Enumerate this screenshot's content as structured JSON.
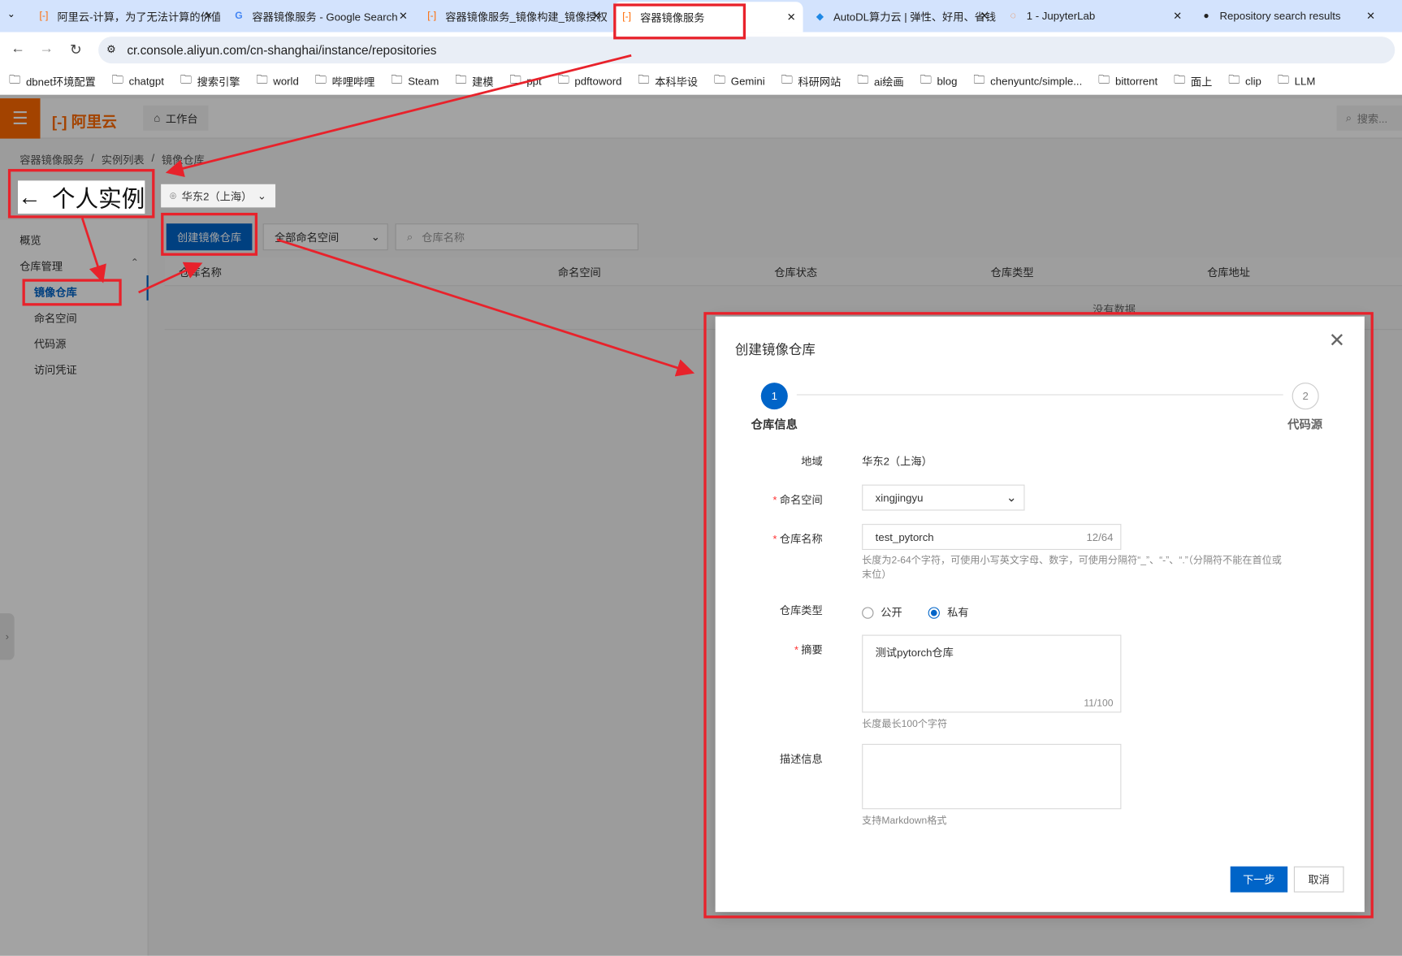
{
  "browser": {
    "tabs": [
      {
        "title": "阿里云-计算，为了无法计算的价值",
        "icon": "aliyun-icon"
      },
      {
        "title": "容器镜像服务 - Google Search",
        "icon": "google-icon"
      },
      {
        "title": "容器镜像服务_镜像构建_镜像授权",
        "icon": "aliyun-icon"
      },
      {
        "title": "容器镜像服务",
        "icon": "aliyun-icon",
        "active": true
      },
      {
        "title": "AutoDL算力云 | 弹性、好用、省钱",
        "icon": "autodl-icon"
      },
      {
        "title": "1 - JupyterLab",
        "icon": "jupyter-icon"
      },
      {
        "title": "Repository search results",
        "icon": "github-icon"
      }
    ],
    "url": "cr.console.aliyun.com/cn-shanghai/instance/repositories",
    "bookmarks": [
      "dbnet环境配置",
      "chatgpt",
      "搜索引擎",
      "world",
      "哔哩哔哩",
      "Steam",
      "建模",
      "ppt",
      "pdftoword",
      "本科毕设",
      "Gemini",
      "科研网站",
      "ai绘画",
      "blog",
      "chenyuntc/simple...",
      "bittorrent",
      "面上",
      "clip",
      "LLM"
    ]
  },
  "header": {
    "logo": "阿里云",
    "workbench": "工作台",
    "search_placeholder": "搜索..."
  },
  "breadcrumb": [
    "容器镜像服务",
    "实例列表",
    "镜像仓库"
  ],
  "page_title": "个人实例",
  "region": "华东2（上海）",
  "sidebar": {
    "items": [
      {
        "label": "概览"
      },
      {
        "label": "仓库管理"
      },
      {
        "label": "镜像仓库",
        "active": true
      },
      {
        "label": "命名空间"
      },
      {
        "label": "代码源"
      },
      {
        "label": "访问凭证"
      }
    ]
  },
  "toolbar": {
    "create_label": "创建镜像仓库",
    "namespace_filter": "全部命名空间",
    "search_placeholder": "仓库名称"
  },
  "table": {
    "columns": [
      "仓库名称",
      "命名空间",
      "仓库状态",
      "仓库类型",
      "仓库地址"
    ],
    "empty": "没有数据"
  },
  "modal": {
    "title": "创建镜像仓库",
    "steps": [
      {
        "num": "1",
        "label": "仓库信息"
      },
      {
        "num": "2",
        "label": "代码源"
      }
    ],
    "region_label": "地域",
    "region_value": "华东2（上海）",
    "namespace_label": "命名空间",
    "namespace_value": "xingjingyu",
    "name_label": "仓库名称",
    "name_value": "test_pytorch",
    "name_count": "12/64",
    "name_hint": "长度为2-64个字符，可使用小写英文字母、数字，可使用分隔符“_”、“-”、“.”（分隔符不能在首位或末位）",
    "type_label": "仓库类型",
    "type_public": "公开",
    "type_private": "私有",
    "type_selected": "私有",
    "summary_label": "摘要",
    "summary_value": "测试pytorch仓库",
    "summary_count": "11/100",
    "summary_hint": "长度最长100个字符",
    "desc_label": "描述信息",
    "desc_hint": "支持Markdown格式",
    "next_label": "下一步",
    "cancel_label": "取消"
  },
  "colors": {
    "primary": "#0064c8",
    "brand": "#ff6a00",
    "annotation": "#e8222b"
  }
}
